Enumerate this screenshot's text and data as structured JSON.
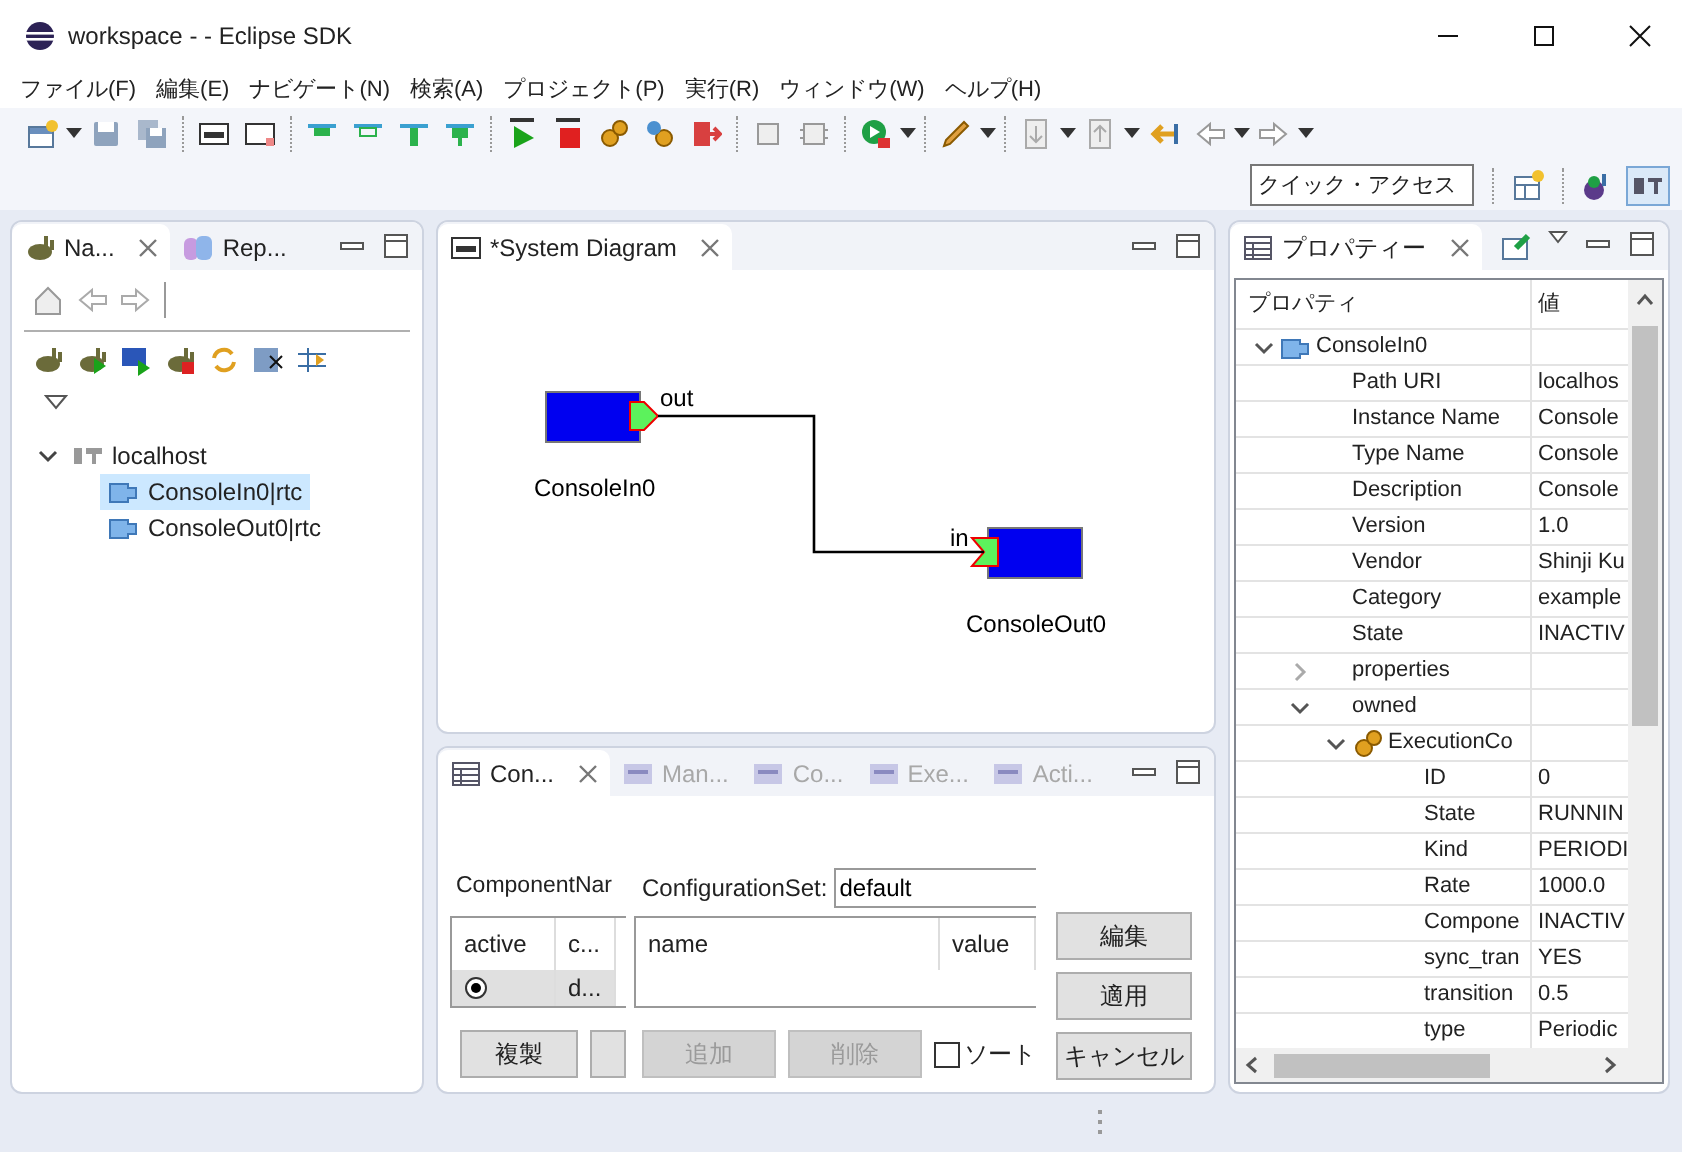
{
  "window": {
    "title": "workspace -  - Eclipse SDK"
  },
  "menu": [
    "ファイル(F)",
    "編集(E)",
    "ナビゲート(N)",
    "検索(A)",
    "プロジェクト(P)",
    "実行(R)",
    "ウィンドウ(W)",
    "ヘルプ(H)"
  ],
  "quick_access": {
    "placeholder": "クイック・アクセス"
  },
  "navigator": {
    "tabs": [
      {
        "label": "Na...",
        "selected": true
      },
      {
        "label": "Rep...",
        "selected": false
      }
    ],
    "tree": [
      {
        "label": "localhost",
        "expanded": true,
        "children": [
          {
            "label": "ConsoleIn0|rtc",
            "selected": true
          },
          {
            "label": "ConsoleOut0|rtc",
            "selected": false
          }
        ]
      }
    ]
  },
  "diagram": {
    "tab": "*System Diagram",
    "components": [
      {
        "name": "ConsoleIn0",
        "port": {
          "label": "out",
          "kind": "output"
        }
      },
      {
        "name": "ConsoleOut0",
        "port": {
          "label": "in",
          "kind": "input"
        }
      }
    ]
  },
  "config": {
    "tabs": [
      {
        "label": "Con...",
        "selected": true,
        "disabled": false
      },
      {
        "label": "Man...",
        "selected": false,
        "disabled": true
      },
      {
        "label": "Co...",
        "selected": false,
        "disabled": true
      },
      {
        "label": "Exe...",
        "selected": false,
        "disabled": true
      },
      {
        "label": "Acti...",
        "selected": false,
        "disabled": true
      }
    ],
    "component_label": "ComponentNar",
    "set_label": "ConfigurationSet:",
    "set_value": "default",
    "sets_table": {
      "columns": [
        "active",
        "c..."
      ],
      "rows": [
        {
          "active": true,
          "selected": true,
          "cells": [
            "",
            "d..."
          ]
        }
      ]
    },
    "values_table": {
      "columns": [
        "name",
        "value"
      ]
    },
    "side_buttons": [
      "編集",
      "適用",
      "キャンセル"
    ],
    "left_buttons": [
      {
        "label": "複製",
        "disabled": false
      }
    ],
    "right_buttons": [
      {
        "label": "追加",
        "disabled": true
      },
      {
        "label": "削除",
        "disabled": true
      }
    ],
    "sort": {
      "label": "ソート",
      "checked": false
    }
  },
  "properties": {
    "tab": "プロパティー",
    "columns": [
      "プロパティ",
      "値"
    ],
    "tree": [
      {
        "label": "ConsoleIn0",
        "kind": "component",
        "expanded": true,
        "children": [
          {
            "label": "Path URI",
            "value": "localhos"
          },
          {
            "label": "Instance Name",
            "value": "Console"
          },
          {
            "label": "Type Name",
            "value": "Console"
          },
          {
            "label": "Description",
            "value": "Console"
          },
          {
            "label": "Version",
            "value": "1.0"
          },
          {
            "label": "Vendor",
            "value": "Shinji Ku"
          },
          {
            "label": "Category",
            "value": "example"
          },
          {
            "label": "State",
            "value": "INACTIV"
          },
          {
            "label": "properties",
            "expanded": false
          },
          {
            "label": "owned",
            "expanded": true,
            "children": [
              {
                "label": "ExecutionCo",
                "kind": "context",
                "expanded": true,
                "children": [
                  {
                    "label": "ID",
                    "value": "0"
                  },
                  {
                    "label": "State",
                    "value": "RUNNIN"
                  },
                  {
                    "label": "Kind",
                    "value": "PERIODI"
                  },
                  {
                    "label": "Rate",
                    "value": "1000.0"
                  },
                  {
                    "label": "Compone",
                    "value": "INACTIV"
                  },
                  {
                    "label": "sync_tran",
                    "value": "YES"
                  },
                  {
                    "label": "transition",
                    "value": "0.5"
                  },
                  {
                    "label": "type",
                    "value": "Periodic"
                  }
                ]
              }
            ]
          }
        ]
      }
    ]
  }
}
